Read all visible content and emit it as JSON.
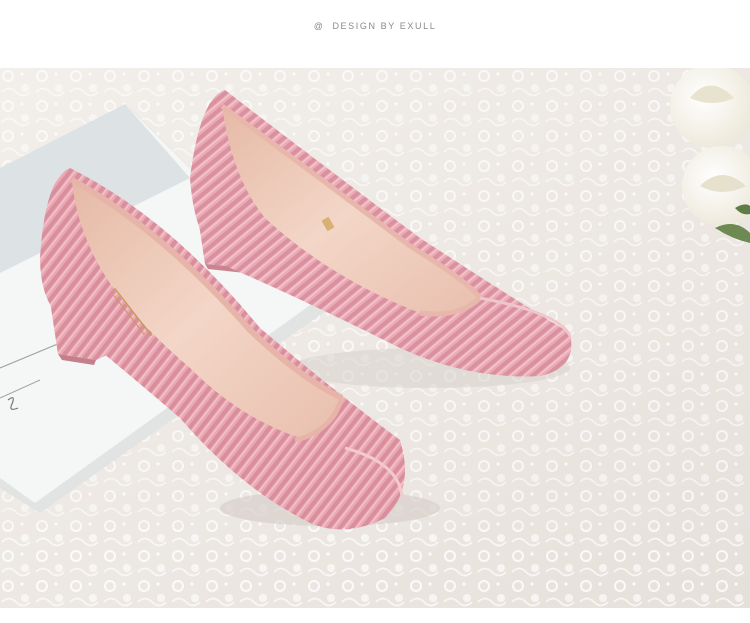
{
  "header": {
    "at_symbol": "@",
    "caption": "DESIGN BY EXULL"
  },
  "photo": {
    "subject": "pink-corduroy-block-heel-pumps",
    "colors": {
      "background_lace": "#efebe6",
      "shoe_pink": "#e8a9b4",
      "lining": "#f2d3c3",
      "book_cover": "#f3f4f4",
      "rose": "#f7f5ee"
    }
  }
}
